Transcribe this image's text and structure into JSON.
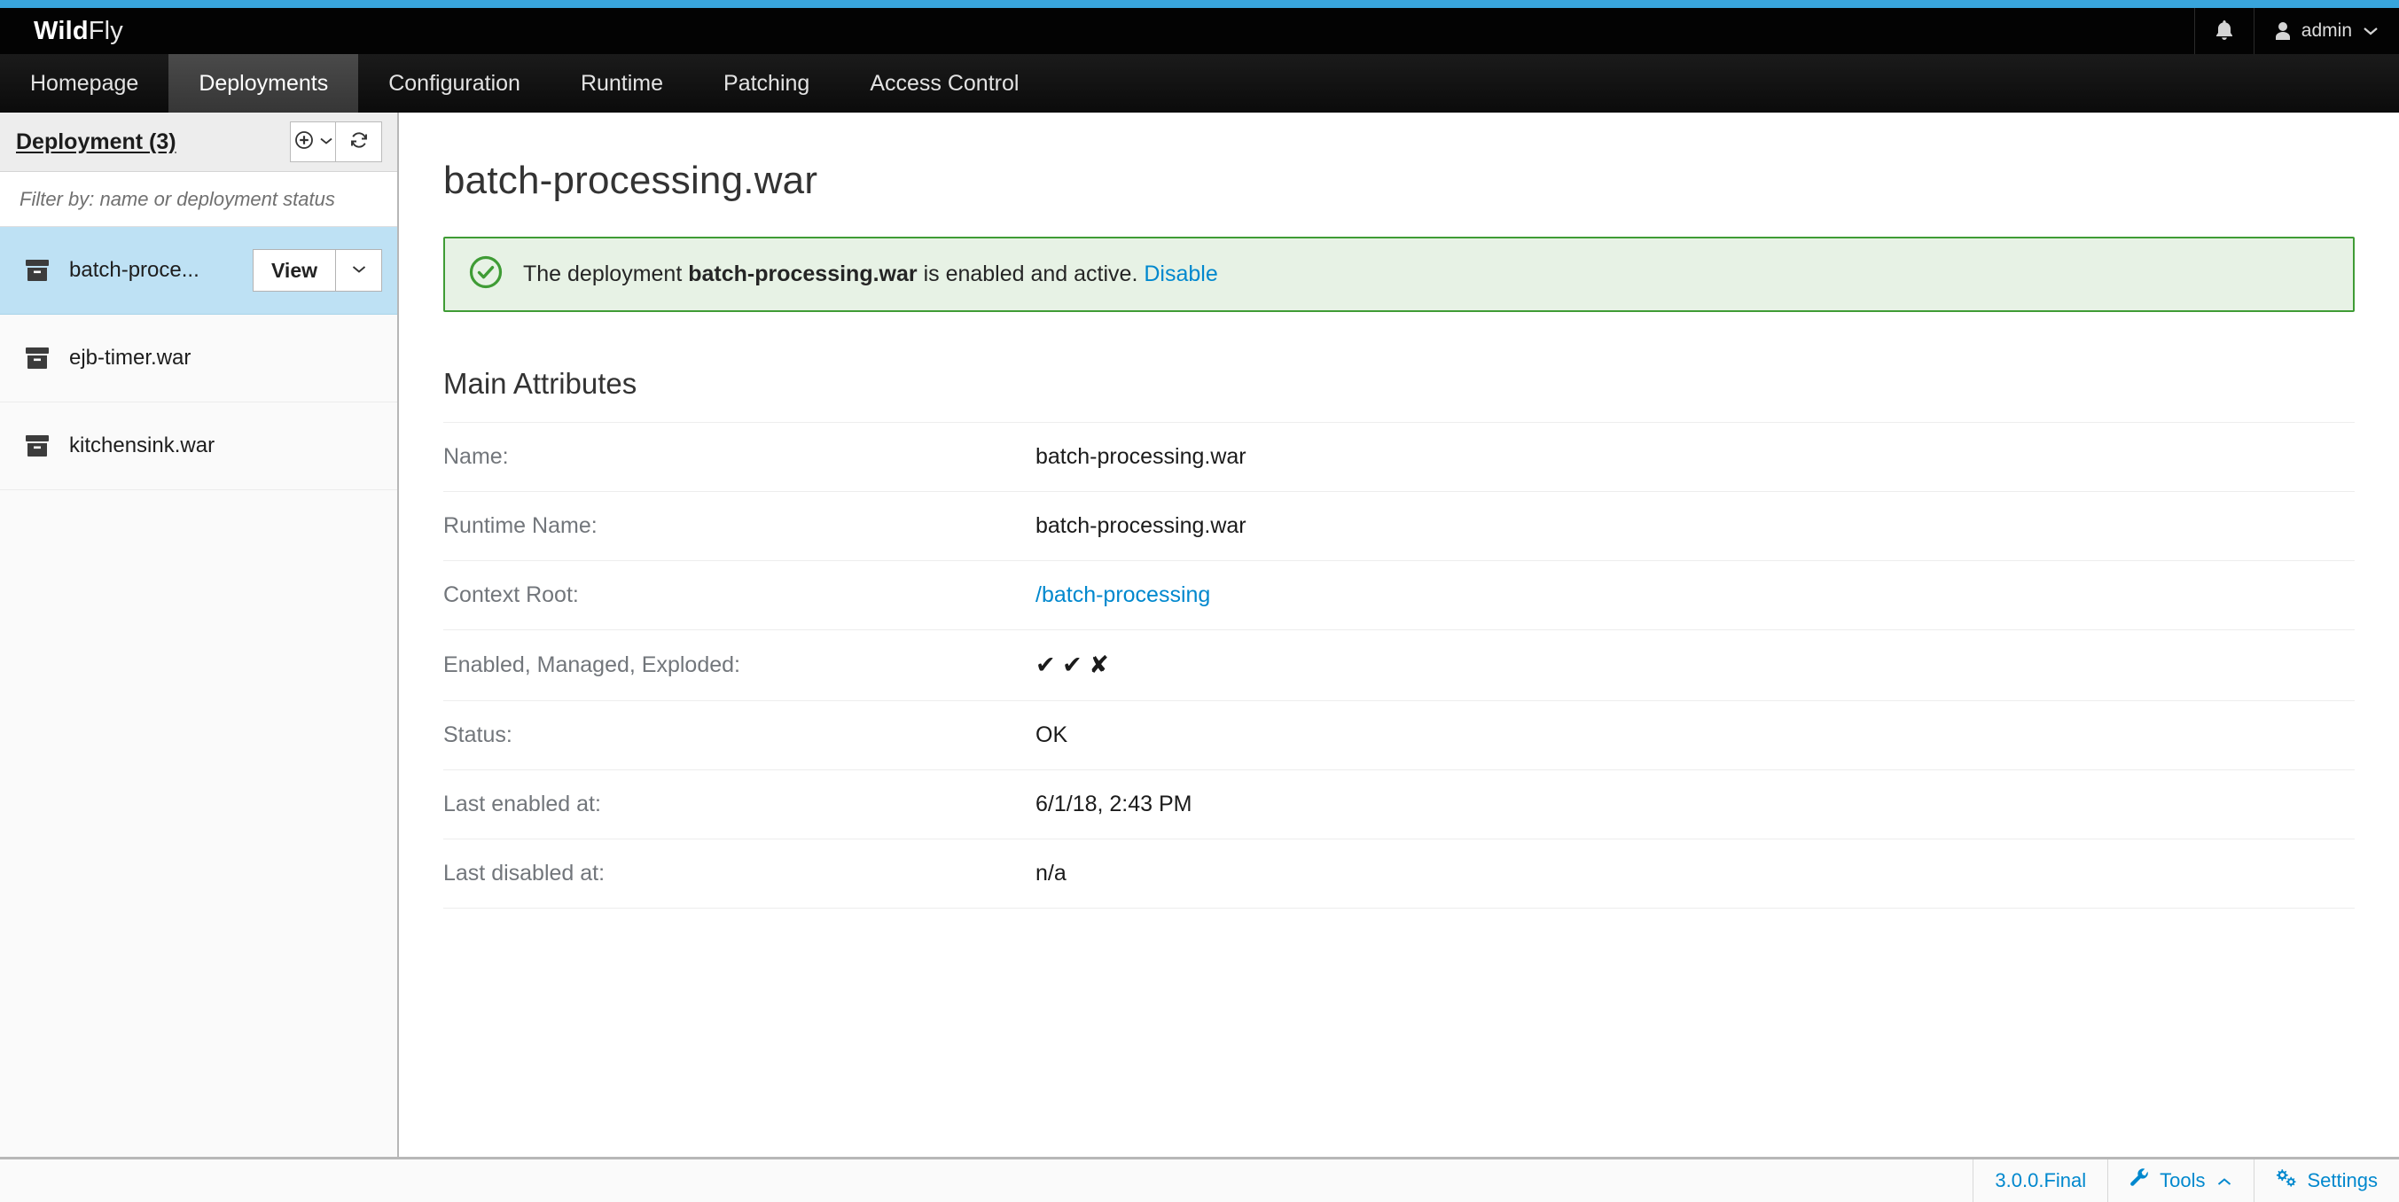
{
  "brand": {
    "part1": "Wild",
    "part2": "Fly"
  },
  "masthead": {
    "notifications_icon": "bell-icon",
    "user_icon": "user-icon",
    "user_label": "admin",
    "user_caret": "chevron-down-icon"
  },
  "nav": {
    "items": [
      {
        "label": "Homepage",
        "active": false
      },
      {
        "label": "Deployments",
        "active": true
      },
      {
        "label": "Configuration",
        "active": false
      },
      {
        "label": "Runtime",
        "active": false
      },
      {
        "label": "Patching",
        "active": false
      },
      {
        "label": "Access Control",
        "active": false
      }
    ]
  },
  "sidebar": {
    "title": "Deployment (3)",
    "add_button": {
      "icon": "plus-circle-icon",
      "caret": "chevron-down-icon"
    },
    "refresh_button": {
      "icon": "refresh-icon"
    },
    "filter": {
      "placeholder": "Filter by: name or deployment status",
      "value": ""
    },
    "items": [
      {
        "icon": "archive-icon",
        "label": "batch-proce...",
        "selected": true,
        "view_label": "View",
        "caret": "chevron-down-icon"
      },
      {
        "icon": "archive-icon",
        "label": "ejb-timer.war",
        "selected": false
      },
      {
        "icon": "archive-icon",
        "label": "kitchensink.war",
        "selected": false
      }
    ]
  },
  "main": {
    "title": "batch-processing.war",
    "alert": {
      "icon": "check-circle-icon",
      "prefix": "The deployment ",
      "strong": "batch-processing.war",
      "suffix": " is enabled and active.",
      "action_label": "Disable",
      "border_color": "#3f9c35",
      "bg_color": "#e7f2e5"
    },
    "section_title": "Main Attributes",
    "attributes": [
      {
        "label": "Name:",
        "value": "batch-processing.war",
        "type": "text"
      },
      {
        "label": "Runtime Name:",
        "value": "batch-processing.war",
        "type": "text"
      },
      {
        "label": "Context Root:",
        "value": "/batch-processing",
        "type": "link"
      },
      {
        "label": "Enabled, Managed, Exploded:",
        "value": "✔ ✔ ✘",
        "type": "flags"
      },
      {
        "label": "Status:",
        "value": "OK",
        "type": "text"
      },
      {
        "label": "Last enabled at:",
        "value": "6/1/18, 2:43 PM",
        "type": "text"
      },
      {
        "label": "Last disabled at:",
        "value": "n/a",
        "type": "text"
      }
    ]
  },
  "footer": {
    "version": "3.0.0.Final",
    "tools_label": "Tools",
    "tools_icon": "wrench-icon",
    "tools_caret": "chevron-up-icon",
    "settings_label": "Settings",
    "settings_icon": "gears-icon",
    "link_color": "#0088ce"
  }
}
